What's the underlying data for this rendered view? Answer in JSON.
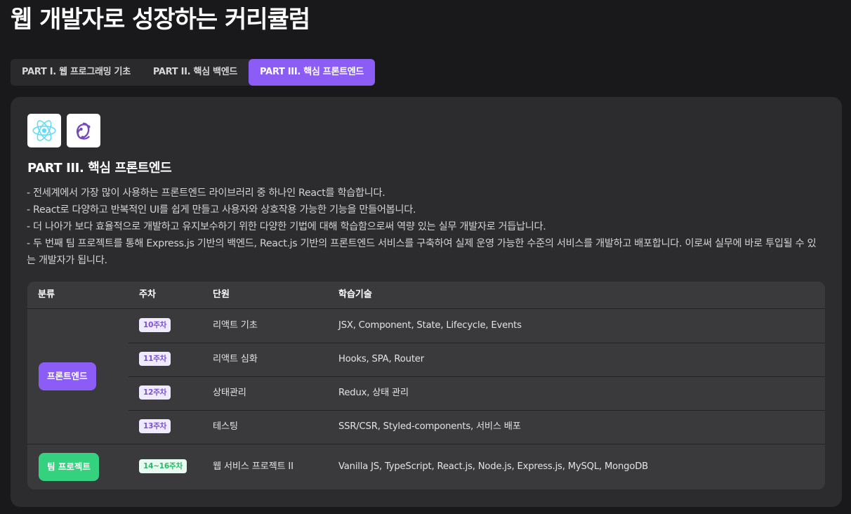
{
  "page": {
    "title": "웹 개발자로 성장하는 커리큘럼"
  },
  "tabs": [
    {
      "label": "PART I. 웹 프로그래밍 기초",
      "active": false
    },
    {
      "label": "PART II. 핵심 백엔드",
      "active": false
    },
    {
      "label": "PART III. 핵심 프론트엔드",
      "active": true
    }
  ],
  "section": {
    "logos": [
      "react-icon",
      "redux-icon"
    ],
    "title": "PART III. 핵심 프론트엔드",
    "description": [
      "- 전세계에서 가장 많이 사용하는 프론트엔드 라이브러리 중 하나인 React를 학습합니다.",
      "- React로 다양하고 반복적인 UI를 쉽게 만들고 사용자와 상호작용 가능한 기능을 만들어봅니다.",
      "- 더 나아가 보다 효율적으로 개발하고 유지보수하기 위한 다양한 기법에 대해 학습함으로써 역량 있는 실무 개발자로 거듭납니다.",
      "- 두 번째 팀 프로젝트를 통해 Express.js 기반의 백엔드, React.js 기반의 프론트엔드 서비스를 구축하여 실제 운영 가능한 수준의 서비스를 개발하고 배포합니다. 이로써 실무에 바로 투입될 수 있는 개발자가 됩니다."
    ]
  },
  "table": {
    "headers": {
      "category": "분류",
      "week": "주차",
      "unit": "단원",
      "tech": "학습기술"
    },
    "groups": [
      {
        "category": "프론트엔드",
        "color": "#8b5cf6",
        "rows": [
          {
            "week": "10주차",
            "unit": "리액트 기초",
            "tech": "JSX, Component, State, Lifecycle, Events"
          },
          {
            "week": "11주차",
            "unit": "리액트 심화",
            "tech": "Hooks, SPA, Router"
          },
          {
            "week": "12주차",
            "unit": "상태관리",
            "tech": "Redux, 상태 관리"
          },
          {
            "week": "13주차",
            "unit": "테스팅",
            "tech": "SSR/CSR, Styled-components, 서비스 배포"
          }
        ]
      },
      {
        "category": "팀 프로젝트",
        "color": "#34d27e",
        "rows": [
          {
            "week": "14~16주차",
            "unit": "웹 서비스 프로젝트 II",
            "tech": "Vanilla JS, TypeScript, React.js, Node.js, Express.js, MySQL, MongoDB"
          }
        ]
      }
    ]
  },
  "colors": {
    "background": "#19191b",
    "panel": "#2c2c2f",
    "table": "#3a3a3d",
    "accent": "#8b5cf6",
    "project": "#34d27e",
    "react_logo": "#61dafb",
    "redux_logo": "#764abc"
  }
}
